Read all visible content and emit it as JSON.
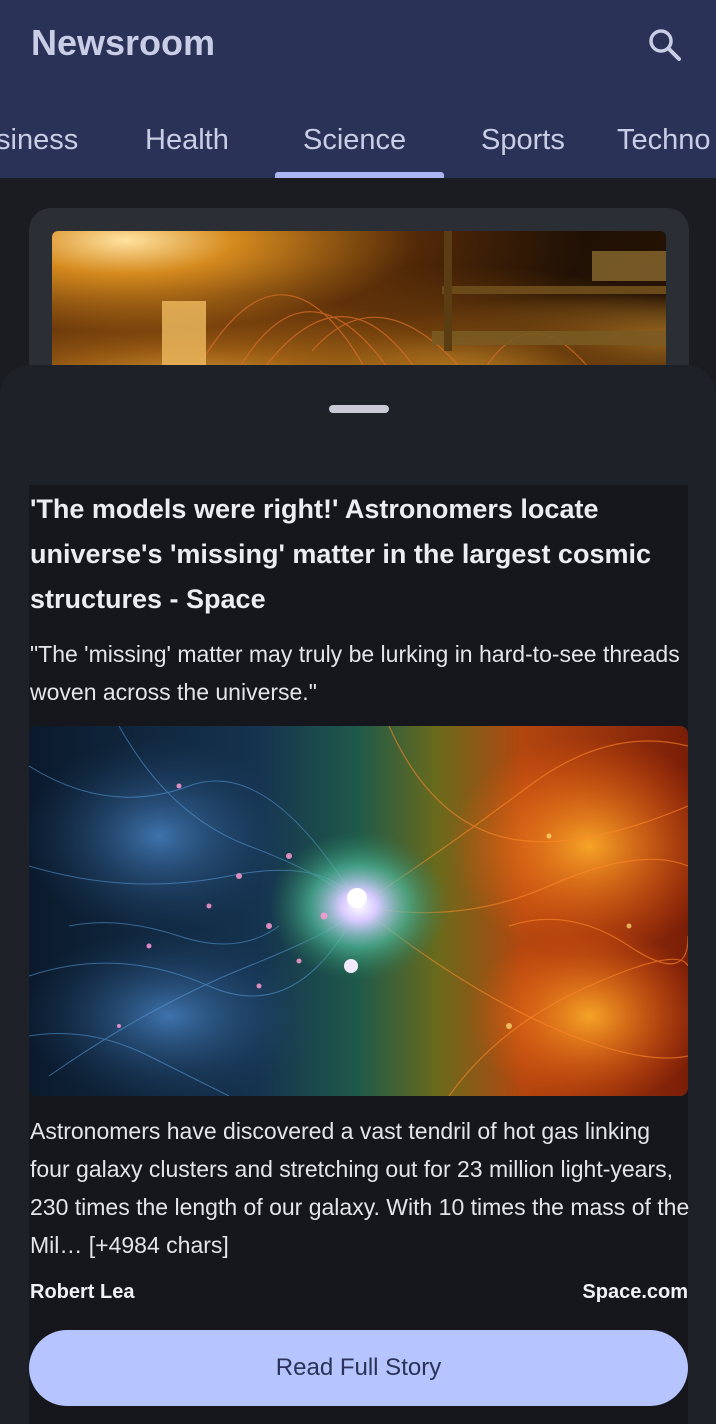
{
  "header": {
    "title": "Newsroom",
    "search_icon": "search-icon"
  },
  "tabs": [
    {
      "label": "siness",
      "selected": false
    },
    {
      "label": "Health",
      "selected": false
    },
    {
      "label": "Science",
      "selected": true
    },
    {
      "label": "Sports",
      "selected": false
    },
    {
      "label": "Techno",
      "selected": false
    }
  ],
  "article": {
    "headline": "'The models were right!' Astronomers locate universe's 'missing' matter in the largest cosmic structures - Space",
    "subtitle": "\"The 'missing' matter may truly be lurking in hard-to-see threads woven across the universe.\"",
    "body": "Astronomers have discovered a vast tendril of hot gas linking four galaxy clusters and stretching out for 23 million light-years, 230 times the length of our galaxy. With 10 times the mass of the Mil… [+4984 chars]",
    "author": "Robert Lea",
    "source": "Space.com",
    "read_button": "Read Full Story"
  },
  "colors": {
    "appbar": "#2a3357",
    "accent": "#b6c4ff",
    "tab_indicator": "#aab5f2",
    "sheet": "#1f2129"
  }
}
